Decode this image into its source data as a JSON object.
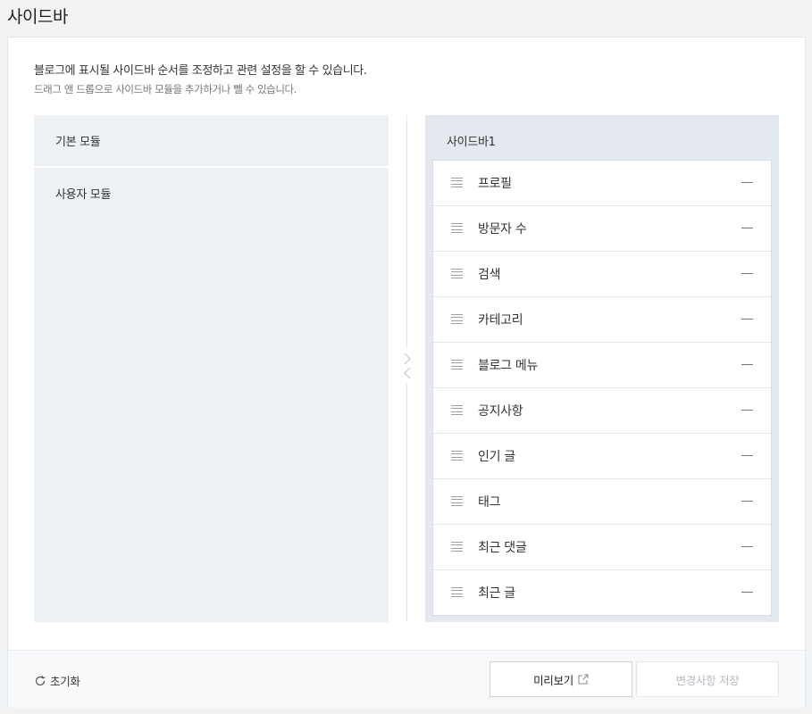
{
  "header": {
    "title": "사이드바"
  },
  "description": {
    "line1": "블로그에 표시될 사이드바 순서를 조정하고 관련 설정을 할 수 있습니다.",
    "line2": "드래그 앤 드롭으로 사이드바 모듈을 추가하거나 뺄 수 있습니다."
  },
  "modules": {
    "basic_label": "기본 모듈",
    "user_label": "사용자 모듈"
  },
  "sidebar": {
    "title": "사이드바1",
    "items": [
      {
        "label": "프로필"
      },
      {
        "label": "방문자 수"
      },
      {
        "label": "검색"
      },
      {
        "label": "카테고리"
      },
      {
        "label": "블로그 메뉴"
      },
      {
        "label": "공지사항"
      },
      {
        "label": "인기 글"
      },
      {
        "label": "태그"
      },
      {
        "label": "최근 댓글"
      },
      {
        "label": "최근 글"
      }
    ]
  },
  "footer": {
    "reset_label": "초기화",
    "preview_label": "미리보기",
    "save_label": "변경사항 저장"
  },
  "icons": {
    "reset": "refresh-icon",
    "external": "external-link-icon",
    "drag": "drag-handle-icon",
    "remove": "minus-icon",
    "move_right": "chevron-right-icon",
    "move_left": "chevron-left-icon"
  },
  "colors": {
    "module_bg": "#edf1f4",
    "sidebar_bg": "#e3e9ef",
    "save_disabled_text": "#b6bbc1"
  }
}
